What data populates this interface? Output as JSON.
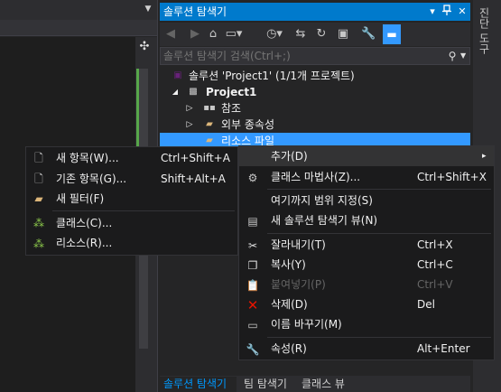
{
  "solution_explorer": {
    "title": "솔루션 탐색기",
    "title_buttons": [
      "▾",
      "⊣",
      "✕"
    ],
    "search_placeholder": "솔루션 탐색기 검색(Ctrl+;)",
    "tree": {
      "solution": "솔루션 'Project1' (1/1개 프로젝트)",
      "project": "Project1",
      "references": "참조",
      "external_deps": "외부 종속성",
      "resource_files": "리소스 파일"
    }
  },
  "side_tabs": [
    "진단 도구"
  ],
  "bottom_tabs": [
    "솔루션 탐색기",
    "팀 탐색기",
    "클래스 뷰"
  ],
  "context_menu": {
    "items": [
      {
        "label": "추가(D)",
        "shortcut": "",
        "arrow": "▸"
      },
      {
        "label": "클래스 마법사(Z)...",
        "shortcut": "Ctrl+Shift+X"
      },
      {
        "label": "여기까지 범위 지정(S)",
        "shortcut": ""
      },
      {
        "label": "새 솔루션 탐색기 뷰(N)",
        "shortcut": ""
      },
      {
        "label": "잘라내기(T)",
        "shortcut": "Ctrl+X"
      },
      {
        "label": "복사(Y)",
        "shortcut": "Ctrl+C"
      },
      {
        "label": "붙여넣기(P)",
        "shortcut": "Ctrl+V"
      },
      {
        "label": "삭제(D)",
        "shortcut": "Del"
      },
      {
        "label": "이름 바꾸기(M)",
        "shortcut": ""
      },
      {
        "label": "속성(R)",
        "shortcut": "Alt+Enter"
      }
    ]
  },
  "add_submenu": {
    "items": [
      {
        "label": "새 항목(W)...",
        "shortcut": "Ctrl+Shift+A"
      },
      {
        "label": "기존 항목(G)...",
        "shortcut": "Shift+Alt+A"
      },
      {
        "label": "새 필터(F)",
        "shortcut": ""
      },
      {
        "label": "클래스(C)...",
        "shortcut": ""
      },
      {
        "label": "리소스(R)...",
        "shortcut": ""
      }
    ]
  },
  "colors": {
    "accent": "#007acc",
    "selection": "#3399ff",
    "delete_icon": "#e51400"
  }
}
